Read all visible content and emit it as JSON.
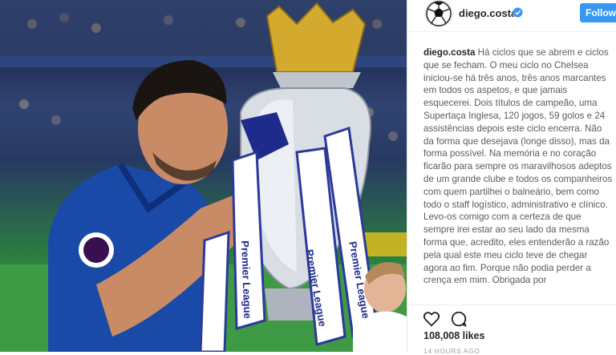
{
  "post": {
    "photo_label": "Premier League trophy celebration photo",
    "trophy_ribbon_text": "Premier League"
  },
  "header": {
    "username": "diego.costa",
    "follow_label": "Follow",
    "verified_icon": "verified-badge-icon",
    "avatar_icon": "soccer-ball-icon"
  },
  "caption": {
    "username": "diego.costa",
    "text": "Há ciclos que se abrem e ciclos que se fecham. O meu ciclo no Chelsea iniciou-se há três anos, três anos marcantes em todos os aspetos, e que jamais esquecerei. Dois títulos de campeão, uma Supertaça Inglesa, 120 jogos, 59 golos e 24 assistências depois este ciclo encerra. Não da forma que desejava (longe disso), mas da forma possível. Na memória e no coração ficarão para sempre os maravilhosos adeptos de um grande clube e todos os companheiros com quem partilhei o balneário, bem como todo o staff logístico, administrativo e clínico. Levo-os comigo com a certeza de que sempre irei estar ao seu lado da mesma forma que, acredito, eles entenderão a razão pela qual este meu ciclo teve de chegar agora ao fim. Porque não podia perder a crença em mim. Obrigada por"
  },
  "actions": {
    "like_icon": "heart-icon",
    "comment_icon": "comment-icon",
    "likes": "108,008 likes",
    "time": "14 HOURS AGO"
  },
  "colors": {
    "follow_button": "#3897f0",
    "verified": "#3897f0",
    "jersey": "#1a4aa8"
  }
}
